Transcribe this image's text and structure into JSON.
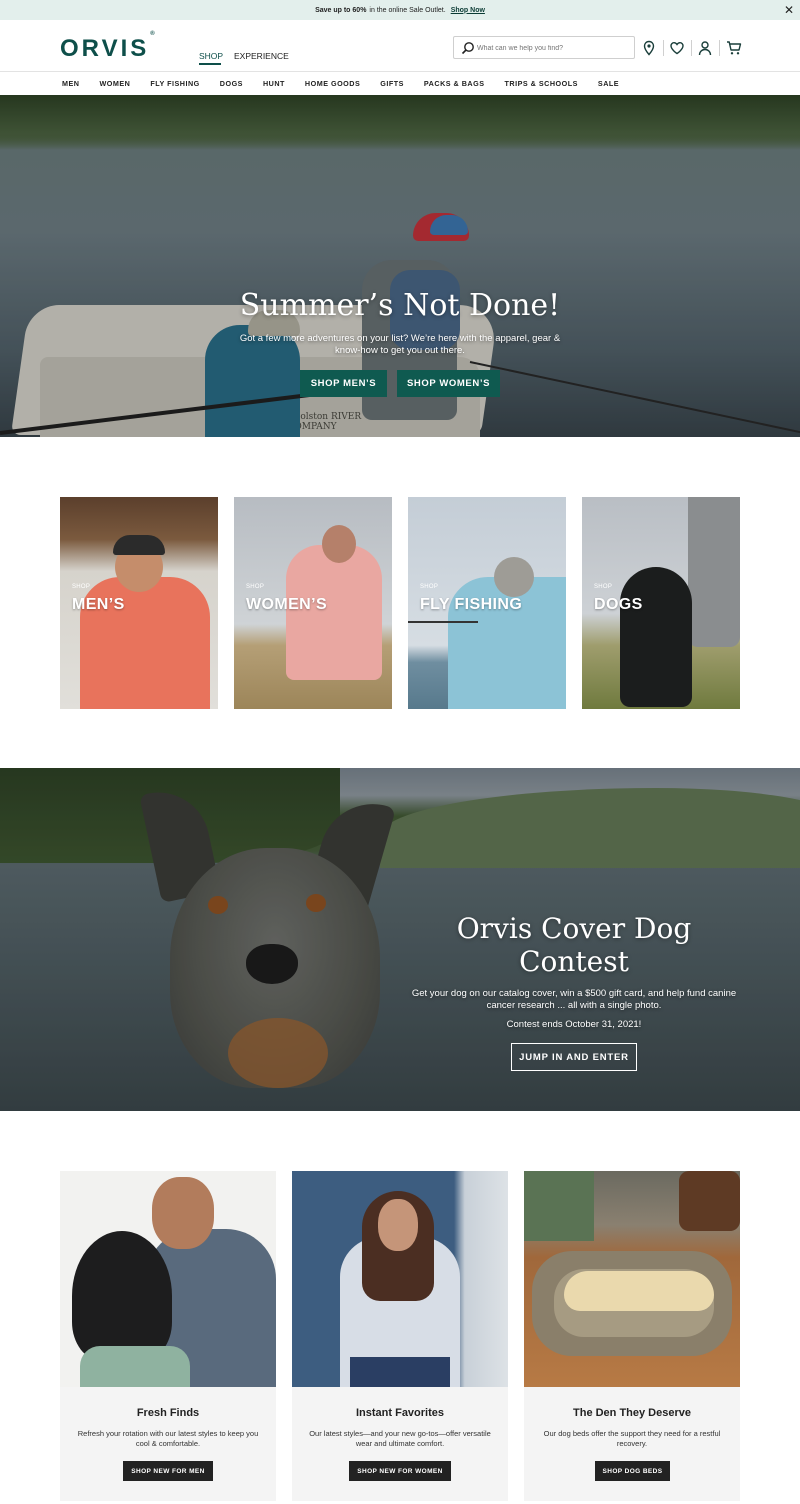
{
  "promo": {
    "lead": "Save up to 60%",
    "text": "in the online Sale Outlet.",
    "link": "Shop Now",
    "close": "✕"
  },
  "header": {
    "logo": "ORVIS",
    "logo_mark": "®",
    "tabs": [
      "SHOP",
      "EXPERIENCE"
    ],
    "active_tab": "SHOP",
    "search_placeholder": "What can we help you find?",
    "icons": [
      "location-icon",
      "heart-icon",
      "account-icon",
      "cart-icon"
    ]
  },
  "nav": [
    "MEN",
    "WOMEN",
    "FLY FISHING",
    "DOGS",
    "HUNT",
    "HOME GOODS",
    "GIFTS",
    "PACKS & BAGS",
    "TRIPS & SCHOOLS",
    "SALE"
  ],
  "hero": {
    "title": "Summer’s Not Done!",
    "subtitle": "Got a few more adventures on your list? We’re here with the apparel, gear & know-how to get you out there.",
    "buttons": [
      "SHOP MEN’S",
      "SHOP WOMEN’S"
    ],
    "boat_text": "South Holston RIVER COMPANY"
  },
  "tiles": [
    {
      "kicker": "SHOP",
      "label": "MEN’S"
    },
    {
      "kicker": "SHOP",
      "label": "WOMEN’S"
    },
    {
      "kicker": "SHOP",
      "label": "FLY FISHING"
    },
    {
      "kicker": "SHOP",
      "label": "DOGS"
    }
  ],
  "contest": {
    "title": "Orvis Cover Dog Contest",
    "description": "Get your dog on our catalog cover, win a $500 gift card, and help fund canine cancer research ... all with a single photo.",
    "ends": "Contest ends October 31, 2021!",
    "button": "JUMP IN AND ENTER"
  },
  "cards": [
    {
      "title": "Fresh Finds",
      "description": "Refresh your rotation with our latest styles to keep you cool & comfortable.",
      "button": "SHOP NEW FOR MEN"
    },
    {
      "title": "Instant Favorites",
      "description": "Our latest styles—and your new go-tos—offer versatile wear and ultimate comfort.",
      "button": "SHOP NEW FOR WOMEN"
    },
    {
      "title": "The Den They Deserve",
      "description": "Our dog beds offer the support they need for a restful recovery.",
      "button": "SHOP DOG BEDS"
    }
  ],
  "colors": {
    "brand_green": "#0e4f4a",
    "button_green": "#0f5a50",
    "promo_bg": "#e3efec",
    "card_bg": "#f4f4f4",
    "dark_button": "#222222"
  }
}
